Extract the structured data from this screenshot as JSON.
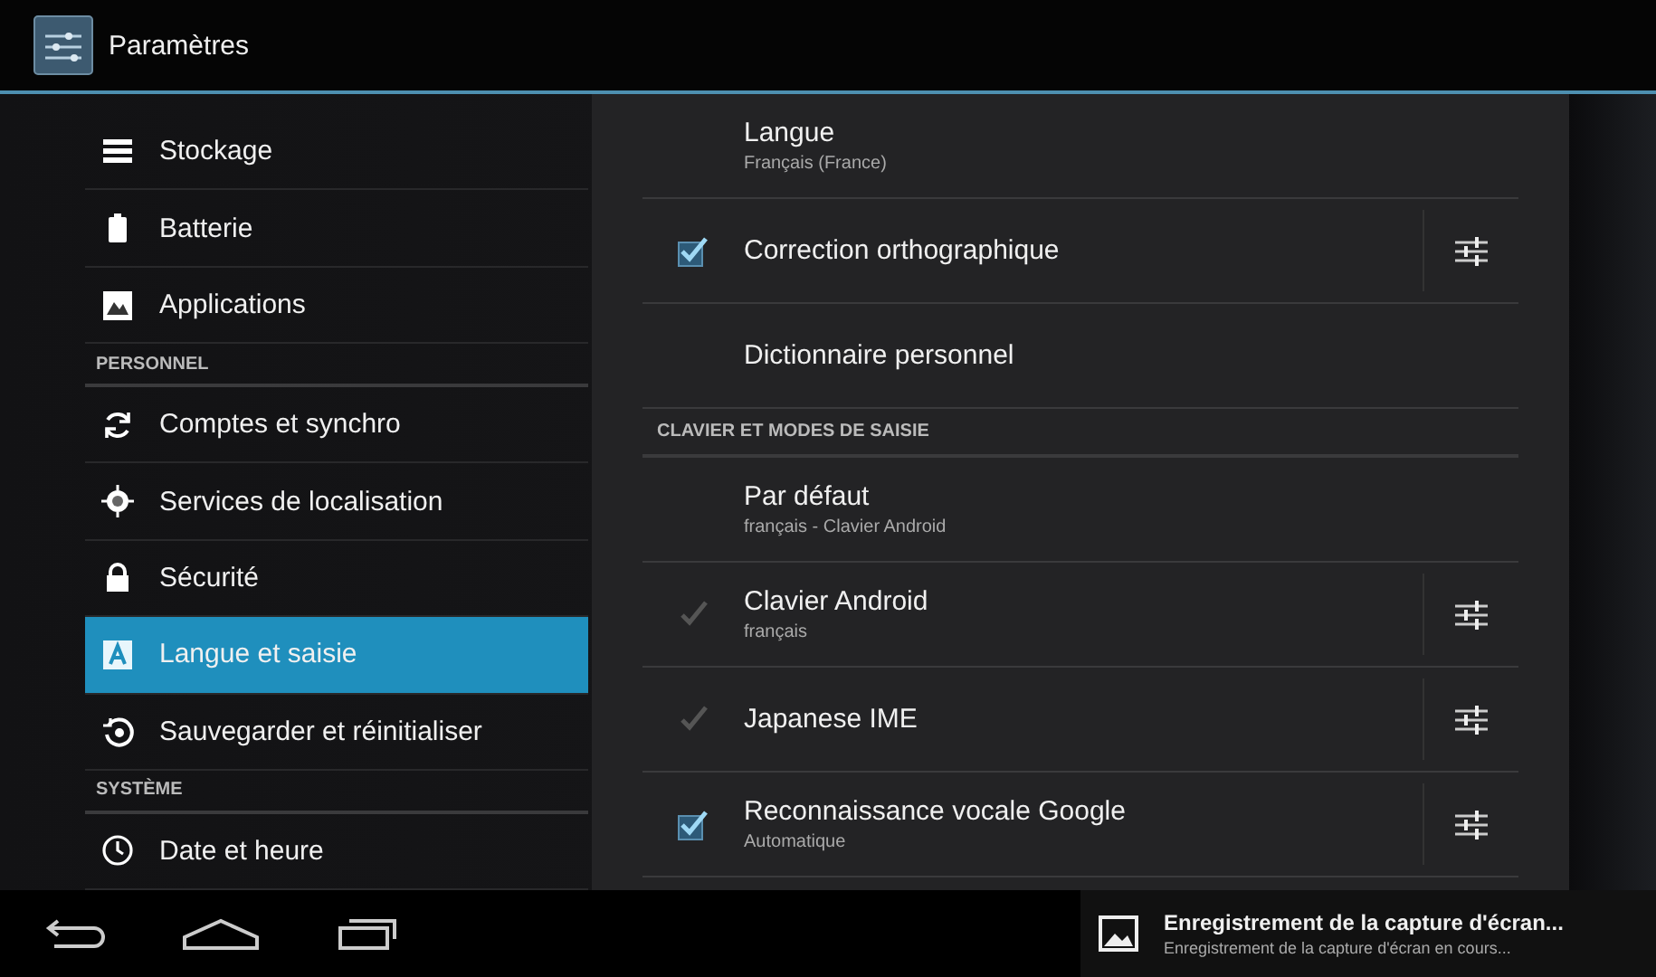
{
  "action_bar": {
    "title": "Paramètres"
  },
  "sidebar": {
    "items": [
      {
        "kind": "item",
        "label": "Stockage",
        "selected": false
      },
      {
        "kind": "item",
        "label": "Batterie",
        "selected": false
      },
      {
        "kind": "item",
        "label": "Applications",
        "selected": false
      },
      {
        "kind": "header",
        "label": "PERSONNEL"
      },
      {
        "kind": "item",
        "label": "Comptes et synchro",
        "selected": false
      },
      {
        "kind": "item",
        "label": "Services de localisation",
        "selected": false
      },
      {
        "kind": "item",
        "label": "Sécurité",
        "selected": false
      },
      {
        "kind": "item",
        "label": "Langue et saisie",
        "selected": true
      },
      {
        "kind": "item",
        "label": "Sauvegarder et réinitialiser",
        "selected": false
      },
      {
        "kind": "header",
        "label": "SYSTÈME"
      },
      {
        "kind": "item",
        "label": "Date et heure",
        "selected": false
      }
    ]
  },
  "preferences": [
    {
      "kind": "item",
      "title": "Langue",
      "summary": "Français (France)"
    },
    {
      "kind": "check",
      "title": "Correction orthographique",
      "checked": true,
      "disabled": false
    },
    {
      "kind": "item",
      "title": "Dictionnaire personnel"
    },
    {
      "kind": "header",
      "title": "CLAVIER ET MODES DE SAISIE"
    },
    {
      "kind": "item",
      "title": "Par défaut",
      "summary": "français - Clavier Android"
    },
    {
      "kind": "check",
      "title": "Clavier Android",
      "summary": "français",
      "checked": true,
      "disabled": true
    },
    {
      "kind": "check",
      "title": "Japanese IME",
      "checked": true,
      "disabled": true
    },
    {
      "kind": "check",
      "title": "Reconnaissance vocale Google",
      "summary": "Automatique",
      "checked": true,
      "disabled": false
    }
  ],
  "notification": {
    "title": "Enregistrement de la capture d'écran...",
    "text": "Enregistrement de la capture d'écran en cours..."
  }
}
